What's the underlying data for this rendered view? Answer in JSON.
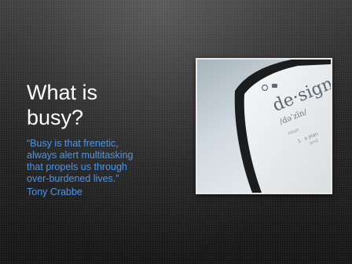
{
  "slide": {
    "title": "What is\nbusy?",
    "quote": "“Busy is that frenetic,\nalways alert multitasking\nthat propels us through\nover-burdened lives.”",
    "author": "Tony Crabbe"
  },
  "photo": {
    "screen_word": "de·sign",
    "screen_pronunciation": "/dəˈzīn/",
    "screen_pos": "noun",
    "screen_item_number": "1.",
    "screen_item_text": "a plan",
    "screen_item_text_2": "and"
  },
  "colors": {
    "title": "#ffffff",
    "quote": "#4f95e6",
    "background": "#232323"
  }
}
